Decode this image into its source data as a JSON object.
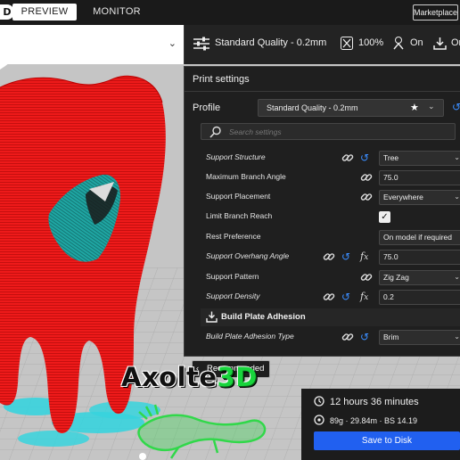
{
  "header": {
    "logo_letter": "D",
    "tabs": [
      {
        "label": "PREVIEW",
        "active": true
      },
      {
        "label": "MONITOR",
        "active": false
      }
    ],
    "marketplace_label": "Marketplace"
  },
  "toolbar": {
    "profile_summary": "Standard Quality - 0.2mm",
    "infill": "100%",
    "support": "On",
    "adhesion": "On"
  },
  "print_settings": {
    "title": "Print settings",
    "profile_label": "Profile",
    "profile_value": "Standard Quality - 0.2mm",
    "search_placeholder": "Search settings",
    "rows": [
      {
        "label": "Support Structure",
        "value": "Tree"
      },
      {
        "label": "Maximum Branch Angle",
        "value": "75.0"
      },
      {
        "label": "Support Placement",
        "value": "Everywhere"
      },
      {
        "label": "Limit Branch Reach",
        "checked": true
      },
      {
        "label": "Rest Preference",
        "value": "On model if required"
      },
      {
        "label": "Support Overhang Angle",
        "value": "75.0"
      },
      {
        "label": "Support Pattern",
        "value": "Zig Zag"
      },
      {
        "label": "Support Density",
        "value": "0.2"
      }
    ],
    "category": "Build Plate Adhesion",
    "adhesion_row": {
      "label": "Build Plate Adhesion Type",
      "value": "Brim"
    },
    "recommended_label": "Recommended"
  },
  "watermark": {
    "text": "Axolte",
    "text_3d": "3D"
  },
  "action_panel": {
    "print_time": "12 hours 36 minutes",
    "material": "89g · 29.84m · BS 14.19",
    "save_label": "Save to Disk"
  },
  "colors": {
    "accent": "#2160f0",
    "reset_icon": "#3a8dff",
    "model_red": "#e81616",
    "model_teal": "#1a9a98",
    "skirt_cyan": "#37d3dd",
    "axolotl_green": "#31d84a"
  }
}
